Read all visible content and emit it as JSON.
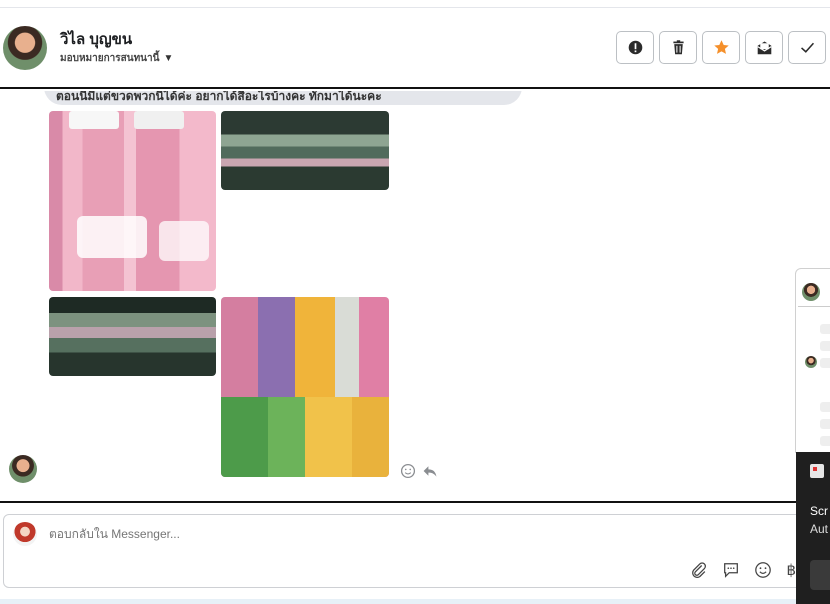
{
  "header": {
    "contact_name": "วิไล บุญขน",
    "assign_label": "มอบหมายการสนทนานี้",
    "actions": [
      {
        "name": "report-spam-button",
        "icon": "exclamation-circle-icon"
      },
      {
        "name": "delete-button",
        "icon": "trash-icon"
      },
      {
        "name": "star-button",
        "icon": "star-icon",
        "color": "#f5902b"
      },
      {
        "name": "mark-unread-button",
        "icon": "envelope-open-icon"
      },
      {
        "name": "mark-done-button",
        "icon": "checkmark-icon"
      }
    ]
  },
  "chat": {
    "partial_message": "ตอนนี้มีแต่ขวดพวกนี้ได้ค่ะ อยากได้สีอะไรบ้างคะ ทักมาได้นะคะ"
  },
  "composer": {
    "placeholder": "ตอบกลับใน Messenger...",
    "currency_symbol": "฿"
  },
  "toast": {
    "line1": "Scr",
    "line2": "Aut"
  },
  "colors": {
    "star": "#f5902b",
    "divider": "#111111"
  }
}
